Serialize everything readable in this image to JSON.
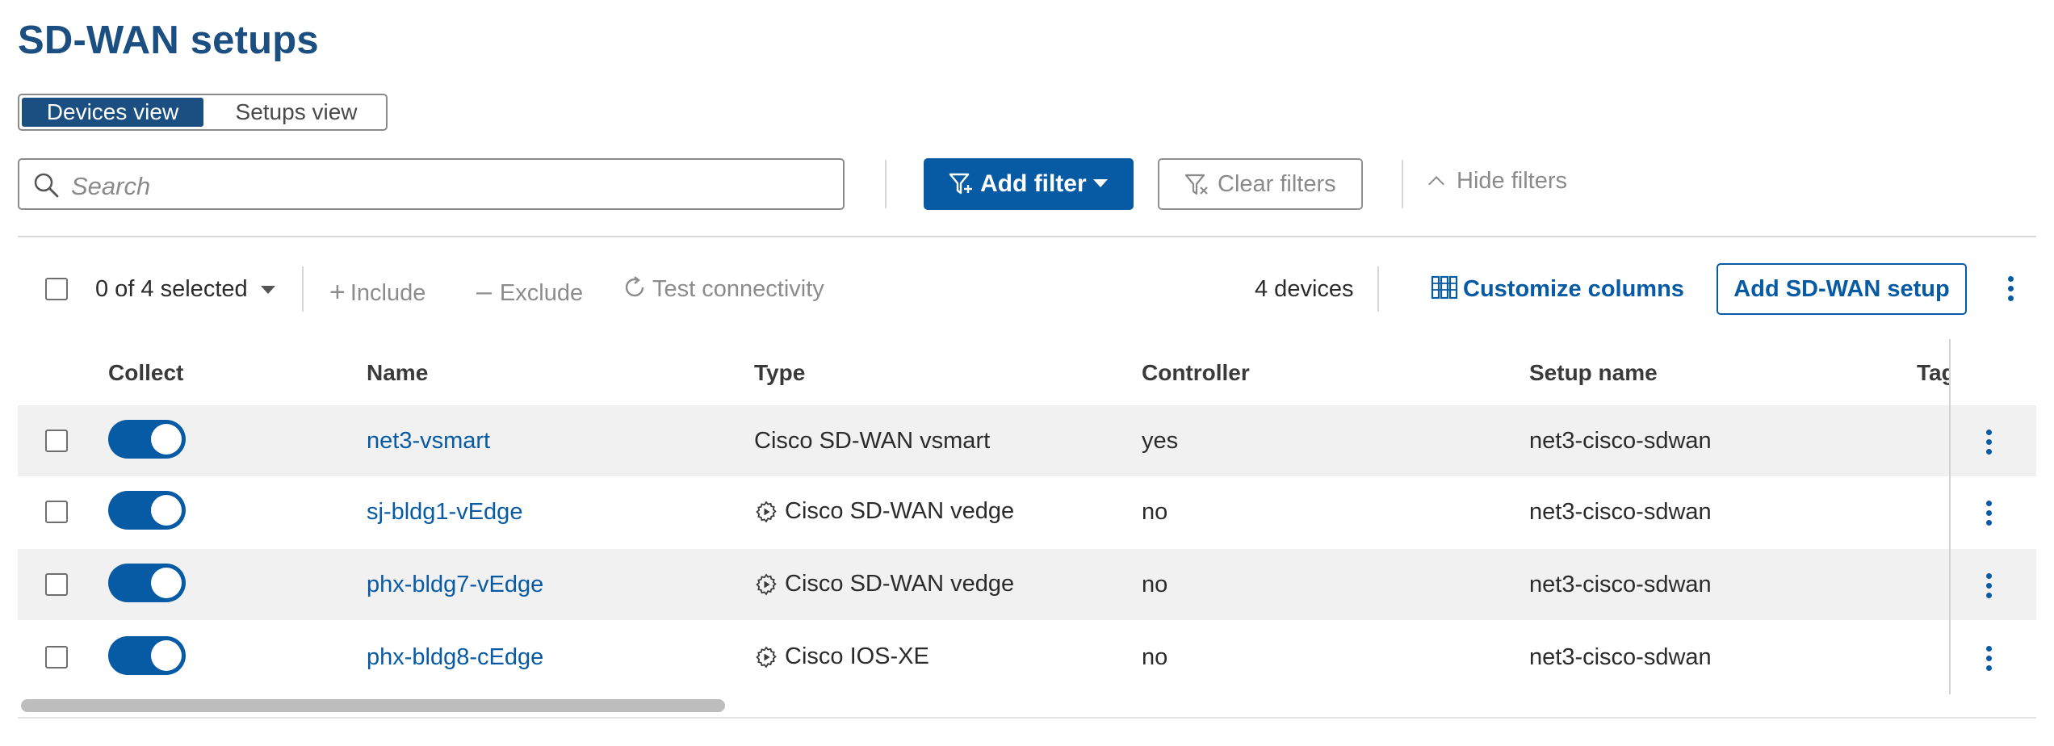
{
  "page": {
    "title": "SD-WAN setups"
  },
  "view_toggle": {
    "devices": "Devices view",
    "setups": "Setups view",
    "active": "devices"
  },
  "filters": {
    "search_placeholder": "Search",
    "add_filter": "Add filter",
    "clear_filters": "Clear filters",
    "hide_filters": "Hide filters"
  },
  "toolbar": {
    "selection": "0 of 4 selected",
    "include": "Include",
    "exclude": "Exclude",
    "test_connectivity": "Test connectivity",
    "device_count": "4 devices",
    "customize_columns": "Customize columns",
    "add_setup": "Add SD-WAN setup"
  },
  "table": {
    "headers": [
      "Collect",
      "Name",
      "Type",
      "Controller",
      "Setup name",
      "Tag"
    ],
    "rows": [
      {
        "collect": true,
        "name": "net3-vsmart",
        "type": "Cisco SD-WAN vsmart",
        "type_icon": "",
        "controller": "yes",
        "setup": "net3-cisco-sdwan"
      },
      {
        "collect": true,
        "name": "sj-bldg1-vEdge",
        "type": "Cisco SD-WAN vedge",
        "type_icon": "gear-play-icon",
        "controller": "no",
        "setup": "net3-cisco-sdwan"
      },
      {
        "collect": true,
        "name": "phx-bldg7-vEdge",
        "type": "Cisco SD-WAN vedge",
        "type_icon": "gear-play-icon",
        "controller": "no",
        "setup": "net3-cisco-sdwan"
      },
      {
        "collect": true,
        "name": "phx-bldg8-cEdge",
        "type": "Cisco IOS-XE",
        "type_icon": "gear-play-icon",
        "controller": "no",
        "setup": "net3-cisco-sdwan"
      }
    ]
  },
  "colors": {
    "brand": "#1b4f82",
    "accent": "#075aa4",
    "row_alt": "#f1f1f1"
  }
}
